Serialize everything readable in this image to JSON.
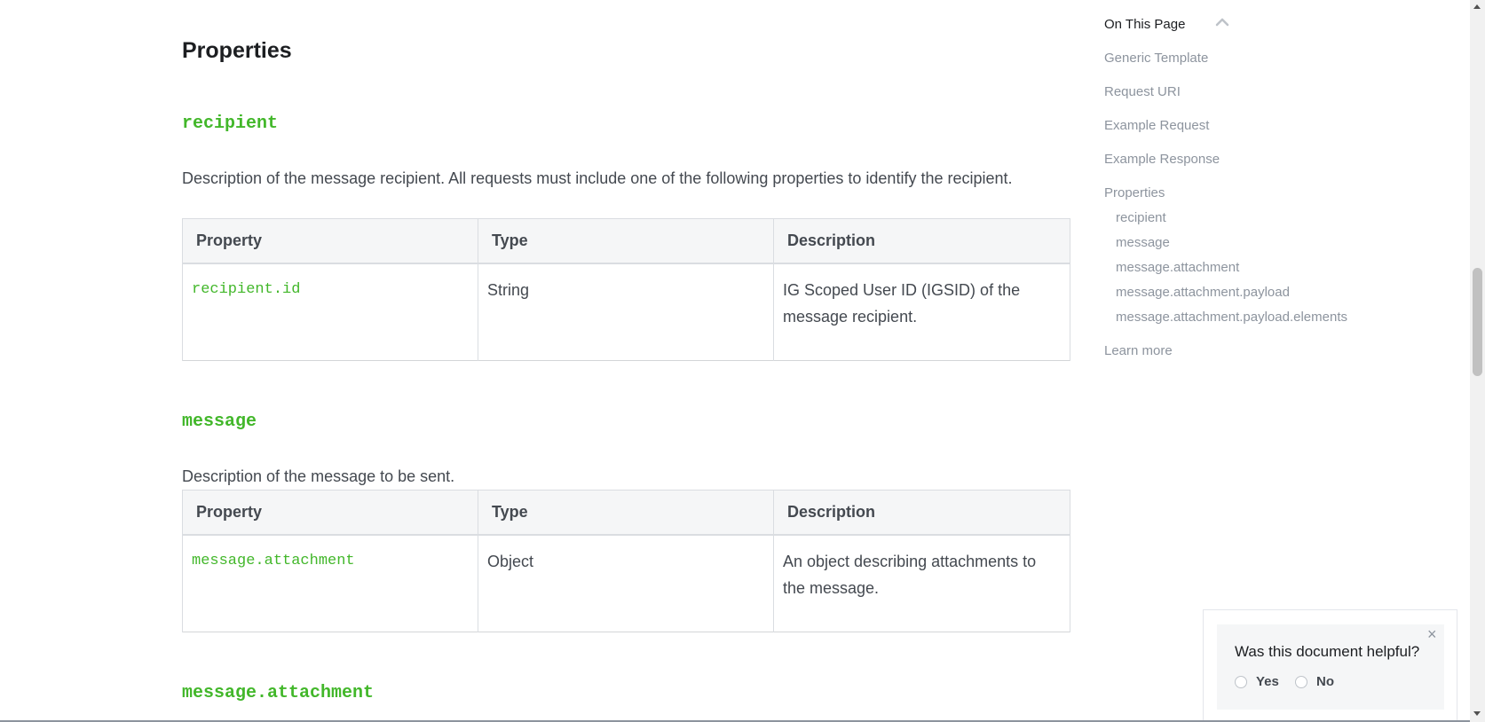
{
  "main": {
    "title": "Properties",
    "sections": [
      {
        "heading": "recipient",
        "description": "Description of the message recipient. All requests must include one of the following properties to identify the recipient.",
        "table": {
          "headers": [
            "Property",
            "Type",
            "Description"
          ],
          "rows": [
            [
              "recipient.id",
              "String",
              "IG Scoped User ID (IGSID) of the message recipient."
            ]
          ]
        }
      },
      {
        "heading": "message",
        "description": "Description of the message to be sent.",
        "table": {
          "headers": [
            "Property",
            "Type",
            "Description"
          ],
          "rows": [
            [
              "message.attachment",
              "Object",
              "An object describing attachments to the message."
            ]
          ]
        }
      },
      {
        "heading": "message.attachment"
      }
    ]
  },
  "toc": {
    "title": "On This Page",
    "items": [
      "Generic Template",
      "Request URI",
      "Example Request",
      "Example Response",
      "Properties"
    ],
    "sub_items": [
      "recipient",
      "message",
      "message.attachment",
      "message.attachment.payload",
      "message.attachment.payload.elements"
    ],
    "learn_more": "Learn more"
  },
  "feedback": {
    "question": "Was this document helpful?",
    "yes": "Yes",
    "no": "No",
    "close": "×"
  },
  "icons": {
    "collapse": "chevron-up-icon",
    "close": "close-icon"
  },
  "colors": {
    "accent": "#42b72a",
    "text": "#1c1e21",
    "muted": "#8d949e"
  }
}
